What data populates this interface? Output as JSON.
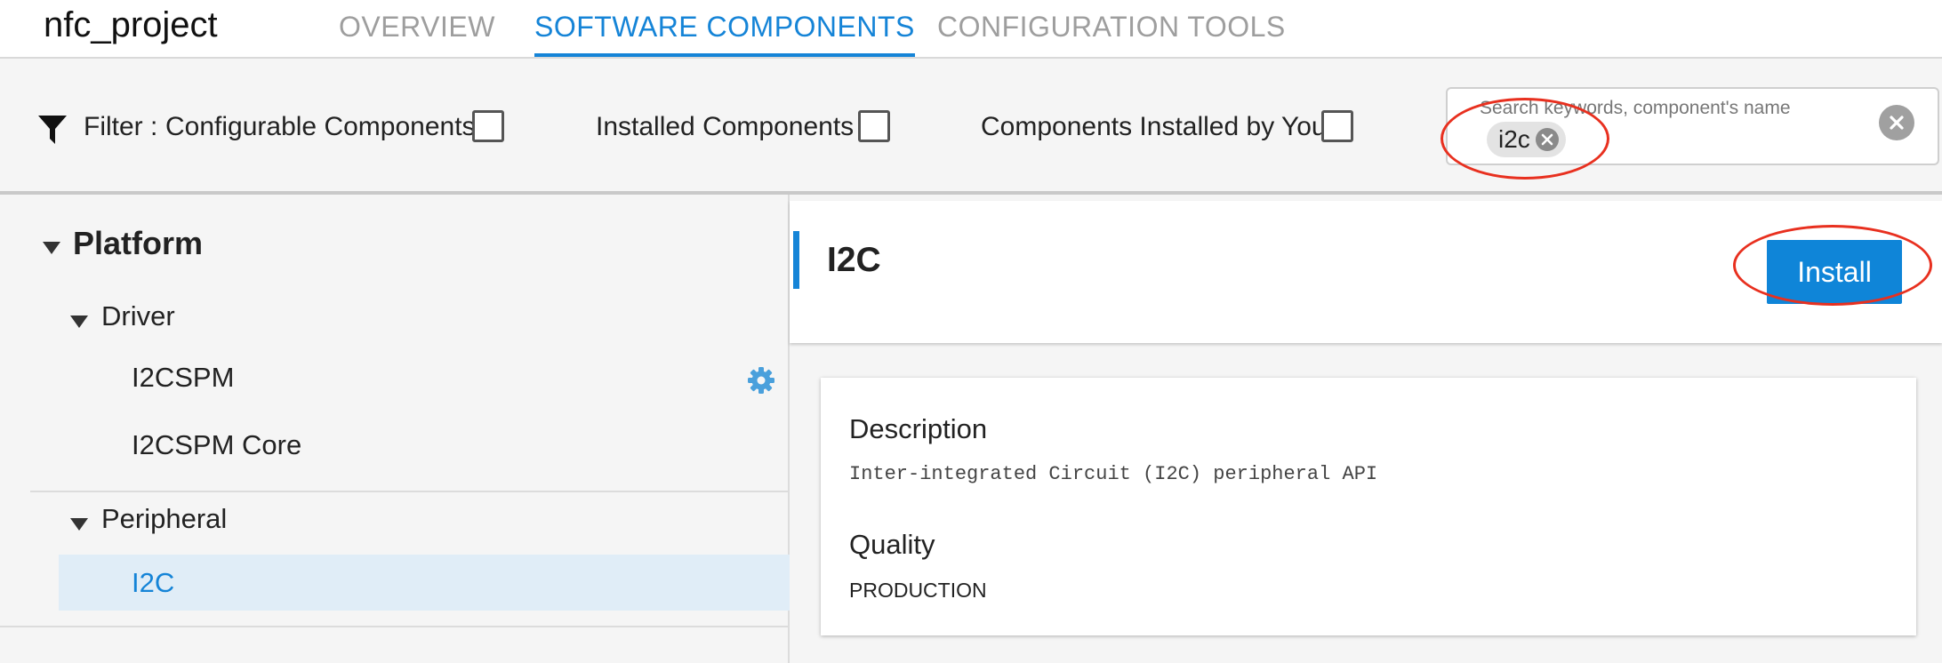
{
  "header": {
    "project_name": "nfc_project",
    "tabs": [
      {
        "label": "OVERVIEW",
        "active": false
      },
      {
        "label": "SOFTWARE COMPONENTS",
        "active": true
      },
      {
        "label": "CONFIGURATION TOOLS",
        "active": false
      }
    ]
  },
  "filter": {
    "label": "Filter :",
    "icon": "funnel-icon",
    "options": [
      {
        "label": "Configurable Components",
        "checked": false
      },
      {
        "label": "Installed Components",
        "checked": false
      },
      {
        "label": "Components Installed by You",
        "checked": false
      }
    ],
    "search": {
      "placeholder": "Search keywords, component's name",
      "chips": [
        "i2c"
      ]
    }
  },
  "tree": {
    "groups": [
      {
        "label": "Platform",
        "expanded": true,
        "subgroups": [
          {
            "label": "Driver",
            "expanded": true,
            "items": [
              {
                "label": "I2CSPM",
                "configurable": true,
                "icon": "gear-icon"
              },
              {
                "label": "I2CSPM Core",
                "configurable": false
              }
            ]
          },
          {
            "label": "Peripheral",
            "expanded": true,
            "items": [
              {
                "label": "I2C",
                "selected": true
              }
            ]
          }
        ]
      }
    ]
  },
  "detail": {
    "title": "I2C",
    "install_label": "Install",
    "description_heading": "Description",
    "description": "Inter-integrated Circuit (I2C) peripheral API",
    "quality_heading": "Quality",
    "quality": "PRODUCTION"
  },
  "colors": {
    "accent": "#1584d7",
    "annotation": "#e8301f",
    "selected_row": "#e0edf7"
  }
}
